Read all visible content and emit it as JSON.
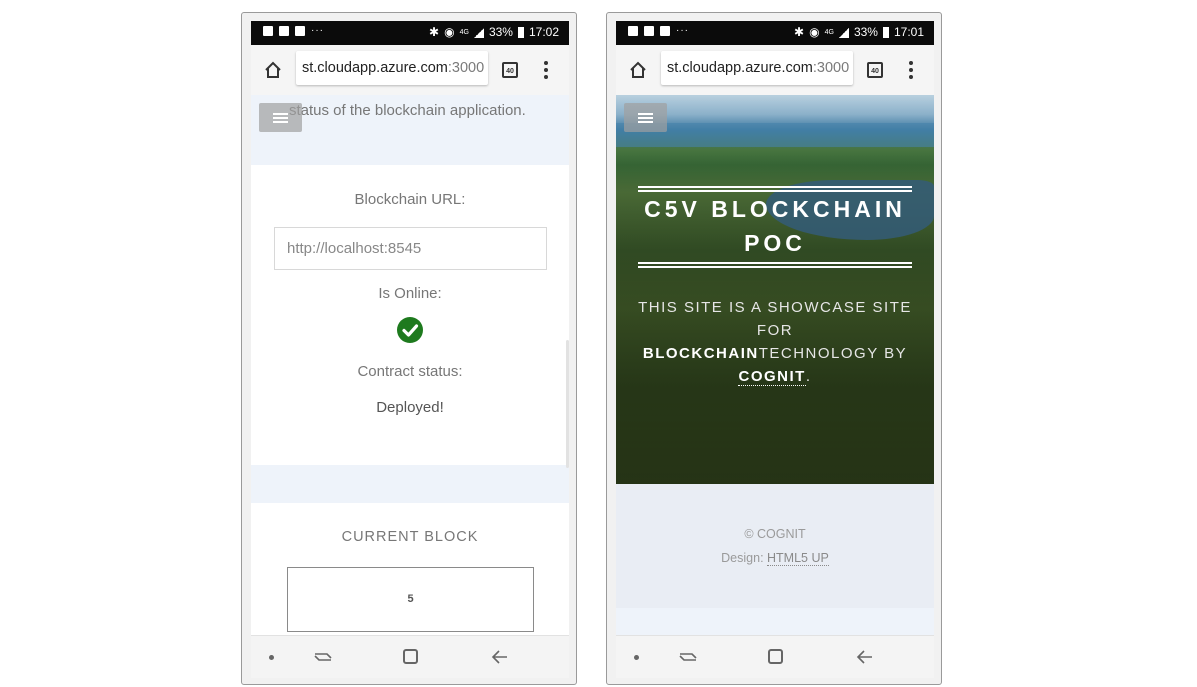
{
  "left_phone": {
    "status": {
      "time": "17:02",
      "battery": "33%",
      "network": "4G",
      "dots": "···"
    },
    "browser": {
      "url_main": "st.cloudapp.azure.com",
      "url_port": ":3000",
      "tab_count": "40"
    },
    "page": {
      "status_text": "status of the blockchain application.",
      "blockchain_url_label": "Blockchain URL:",
      "blockchain_url_value": "http://localhost:8545",
      "is_online_label": "Is Online:",
      "is_online": true,
      "contract_status_label": "Contract status:",
      "contract_status_value": "Deployed!",
      "current_block_label": "CURRENT BLOCK",
      "current_block_value": "5"
    }
  },
  "right_phone": {
    "status": {
      "time": "17:01",
      "battery": "33%",
      "network": "4G",
      "dots": "···"
    },
    "browser": {
      "url_main": "st.cloudapp.azure.com",
      "url_port": ":3000",
      "tab_count": "40"
    },
    "hero": {
      "title_line1": "C5V BLOCKCHAIN",
      "title_line2": "POC",
      "sub_line1": "THIS SITE IS A SHOWCASE SITE",
      "sub_line2": "FOR",
      "sub_blockchain": "BLOCKCHAIN",
      "sub_tech": "TECHNOLOGY BY",
      "sub_cognit": "COGNIT",
      "sub_period": "."
    },
    "footer": {
      "copyright": "© COGNIT",
      "design_label": "Design: ",
      "design_link": "HTML5 UP"
    }
  },
  "colors": {
    "online_check": "#1e7a1e",
    "band": "#eef3fa"
  },
  "icons": [
    "home-icon",
    "tabs-icon",
    "menu-icon",
    "hamburger-icon",
    "check-icon",
    "nav-recent-icon",
    "nav-home-icon",
    "nav-back-icon"
  ]
}
